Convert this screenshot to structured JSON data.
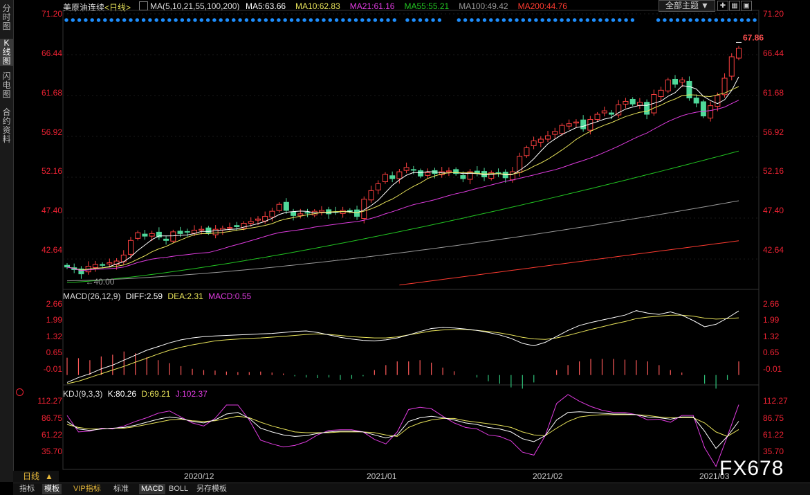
{
  "sidebar": {
    "tabs": [
      {
        "label": "分时图",
        "active": false
      },
      {
        "label": "K线图",
        "active": true
      },
      {
        "label": "闪电图",
        "active": false
      },
      {
        "label": "合约资料",
        "active": false
      }
    ]
  },
  "header": {
    "instrument": "美原油连续",
    "period": "<日线>",
    "ma_params": "MA(5,10,21,55,100,200)",
    "ma_values": [
      {
        "label": "MA5:63.66",
        "color": "#ffffff"
      },
      {
        "label": "MA10:62.83",
        "color": "#e8e35a"
      },
      {
        "label": "MA21:61.16",
        "color": "#e03ce0"
      },
      {
        "label": "MA55:55.21",
        "color": "#22c422"
      },
      {
        "label": "MA100:49.42",
        "color": "#9a9a9a"
      },
      {
        "label": "MA200:44.76",
        "color": "#ff3b30"
      }
    ],
    "theme_button": "全部主题",
    "theme_arrow": "▼"
  },
  "price_axis": {
    "ticks": [
      "71.20",
      "66.44",
      "61.68",
      "56.92",
      "52.16",
      "47.40",
      "42.64"
    ]
  },
  "price_annotations": {
    "high": "67.86",
    "low": "40.00"
  },
  "macd": {
    "title": "MACD(26,12,9)",
    "diff": "DIFF:2.59",
    "dea": "DEA:2.31",
    "macd": "MACD:0.55",
    "ticks": [
      "2.66",
      "1.99",
      "1.32",
      "0.65",
      "-0.01"
    ]
  },
  "kdj": {
    "title": "KDJ(9,3,3)",
    "k": "K:80.26",
    "d": "D:69.21",
    "j": "J:102.37",
    "ticks": [
      "112.27",
      "86.75",
      "61.22",
      "35.70"
    ]
  },
  "x_axis": {
    "labels": [
      "2020/12",
      "2021/01",
      "2021/02",
      "2021/03"
    ]
  },
  "period_label": "日线",
  "period_arrow": "▲",
  "bottom_tabs": [
    {
      "label": "指标",
      "active": false
    },
    {
      "label": "模板",
      "active": true
    },
    {
      "label": "VIP指标",
      "active": false
    },
    {
      "label": "标准",
      "active": false
    },
    {
      "label": "MACD",
      "active": true
    },
    {
      "label": "BOLL",
      "active": false
    },
    {
      "label": "另存模板",
      "active": false
    }
  ],
  "watermark": "FX678",
  "colors": {
    "up": "#ff4040",
    "down": "#4fd89a",
    "diff": "#ffffff",
    "dea": "#e8e35a",
    "macd_pos": "#ff5a5a",
    "macd_neg": "#2fc47a",
    "k": "#ffffff",
    "d": "#e8e35a",
    "j": "#e03ce0",
    "dots": "#1e8fff"
  },
  "chart_data": [
    {
      "type": "candlestick",
      "title": "美原油连续<日线>",
      "ylim": [
        39.5,
        71.2
      ],
      "y_ticks": [
        71.2,
        66.44,
        61.68,
        56.92,
        52.16,
        47.4,
        42.64
      ],
      "x_tick_labels": [
        "2020/12",
        "2021/01",
        "2021/02",
        "2021/03"
      ],
      "close": [
        41.7,
        41.4,
        40.9,
        41.8,
        42.0,
        41.9,
        42.2,
        42.4,
        43.1,
        44.8,
        45.7,
        45.3,
        45.6,
        45.2,
        44.8,
        45.8,
        45.6,
        45.8,
        46.0,
        46.1,
        45.7,
        46.1,
        46.2,
        46.3,
        46.4,
        46.8,
        47.0,
        47.3,
        47.6,
        48.2,
        49.0,
        48.3,
        47.7,
        47.9,
        48.0,
        48.2,
        48.3,
        47.9,
        48.1,
        48.3,
        48.2,
        47.6,
        49.6,
        50.6,
        51.4,
        52.5,
        52.0,
        52.8,
        53.3,
        53.0,
        52.3,
        52.7,
        52.6,
        52.8,
        52.9,
        52.6,
        52.0,
        52.8,
        52.6,
        52.2,
        52.7,
        52.6,
        52.1,
        52.8,
        54.6,
        55.6,
        56.4,
        56.6,
        57.0,
        57.5,
        58.2,
        58.4,
        58.6,
        57.8,
        58.9,
        59.5,
        59.9,
        59.5,
        60.6,
        61.0,
        60.7,
        60.9,
        59.5,
        61.8,
        62.3,
        63.5,
        63.0,
        63.5,
        61.4,
        60.8,
        59.3,
        60.5,
        61.7,
        63.7,
        66.2,
        67.2
      ],
      "ma5_last": 63.66,
      "ma10_last": 62.83,
      "ma21_last": 61.16,
      "ma55_last": 55.21,
      "ma100_last": 49.42,
      "ma200_last": 44.76
    },
    {
      "type": "line",
      "title": "MACD(26,12,9)",
      "ylim": [
        -0.4,
        2.9
      ],
      "series": [
        {
          "name": "DIFF",
          "values": [
            -0.3,
            -0.1,
            0.05,
            0.25,
            0.4,
            0.6,
            0.8,
            1.0,
            1.15,
            1.3,
            1.42,
            1.5,
            1.55,
            1.58,
            1.6,
            1.62,
            1.64,
            1.66,
            1.68,
            1.72,
            1.76,
            1.78,
            1.72,
            1.62,
            1.52,
            1.45,
            1.4,
            1.38,
            1.42,
            1.5,
            1.62,
            1.76,
            1.88,
            1.92,
            1.9,
            1.86,
            1.8,
            1.72,
            1.62,
            1.48,
            1.28,
            1.18,
            1.32,
            1.56,
            1.8,
            2.0,
            2.12,
            2.22,
            2.32,
            2.42,
            2.6,
            2.5,
            2.45,
            2.55,
            2.42,
            2.2,
            1.95,
            2.05,
            2.3,
            2.59
          ]
        },
        {
          "name": "DEA",
          "values": [
            -0.35,
            -0.25,
            -0.1,
            0.05,
            0.2,
            0.35,
            0.52,
            0.68,
            0.85,
            1.0,
            1.12,
            1.22,
            1.3,
            1.38,
            1.42,
            1.45,
            1.48,
            1.5,
            1.53,
            1.56,
            1.6,
            1.64,
            1.66,
            1.64,
            1.6,
            1.55,
            1.52,
            1.5,
            1.5,
            1.54,
            1.62,
            1.7,
            1.78,
            1.82,
            1.84,
            1.84,
            1.8,
            1.76,
            1.7,
            1.62,
            1.52,
            1.46,
            1.44,
            1.5,
            1.6,
            1.72,
            1.84,
            1.95,
            2.06,
            2.16,
            2.28,
            2.34,
            2.38,
            2.42,
            2.42,
            2.38,
            2.3,
            2.26,
            2.28,
            2.31
          ]
        },
        {
          "name": "MACD",
          "values": [
            0.7,
            0.68,
            0.6,
            0.75,
            0.82,
            0.95,
            0.88,
            0.72,
            0.6,
            0.48,
            0.36,
            0.25,
            0.2,
            0.18,
            0.14,
            0.12,
            0.12,
            0.14,
            0.1,
            0.06,
            -0.05,
            -0.1,
            -0.12,
            -0.1,
            -0.2,
            -0.15,
            -0.05,
            0.2,
            0.4,
            0.55,
            0.55,
            0.6,
            0.5,
            0.3,
            0.15,
            0.0,
            -0.1,
            -0.25,
            -0.35,
            -0.5,
            -0.55,
            -0.3,
            0.0,
            0.2,
            0.4,
            0.55,
            0.65,
            0.65,
            0.65,
            0.62,
            0.6,
            0.55,
            0.4,
            0.2,
            0.1,
            0.0,
            -0.35,
            -0.55,
            -0.2,
            0.55
          ]
        }
      ],
      "y_ticks": [
        2.66,
        1.99,
        1.32,
        0.65,
        -0.01
      ]
    },
    {
      "type": "line",
      "title": "KDJ(9,3,3)",
      "ylim": [
        16,
        114
      ],
      "series": [
        {
          "name": "K",
          "values": [
            80,
            70,
            68,
            70,
            71,
            72,
            75,
            79,
            83,
            86,
            84,
            80,
            78,
            82,
            90,
            92,
            84,
            71,
            66,
            62,
            60,
            61,
            64,
            66,
            67,
            67,
            66,
            62,
            58,
            62,
            80,
            85,
            87,
            85,
            82,
            78,
            76,
            72,
            70,
            66,
            57,
            53,
            61,
            82,
            92,
            93,
            92,
            91,
            90,
            90,
            89,
            86,
            85,
            83,
            86,
            86,
            67,
            44,
            60,
            80.26
          ]
        },
        {
          "name": "D",
          "values": [
            76,
            72,
            70,
            70,
            71,
            71,
            73,
            76,
            79,
            82,
            83,
            81,
            80,
            81,
            84,
            87,
            85,
            79,
            74,
            70,
            66,
            65,
            65,
            65,
            66,
            66,
            66,
            65,
            62,
            60,
            72,
            78,
            82,
            84,
            84,
            81,
            79,
            77,
            75,
            72,
            66,
            62,
            61,
            71,
            80,
            86,
            88,
            89,
            89,
            89,
            89,
            88,
            86,
            85,
            85,
            85,
            78,
            66,
            60,
            69.21
          ]
        },
        {
          "name": "J",
          "values": [
            88,
            66,
            67,
            71,
            70,
            74,
            80,
            85,
            91,
            94,
            86,
            78,
            74,
            84,
            102,
            102,
            82,
            55,
            50,
            46,
            48,
            53,
            62,
            68,
            69,
            69,
            66,
            56,
            50,
            66,
            96,
            99,
            97,
            87,
            78,
            72,
            70,
            62,
            60,
            54,
            39,
            35,
            61,
            104,
            116,
            107,
            100,
            95,
            92,
            92,
            89,
            82,
            83,
            79,
            88,
            88,
            45,
            20,
            60,
            102.37
          ]
        }
      ],
      "y_ticks": [
        112.27,
        86.75,
        61.22,
        35.7
      ]
    }
  ]
}
